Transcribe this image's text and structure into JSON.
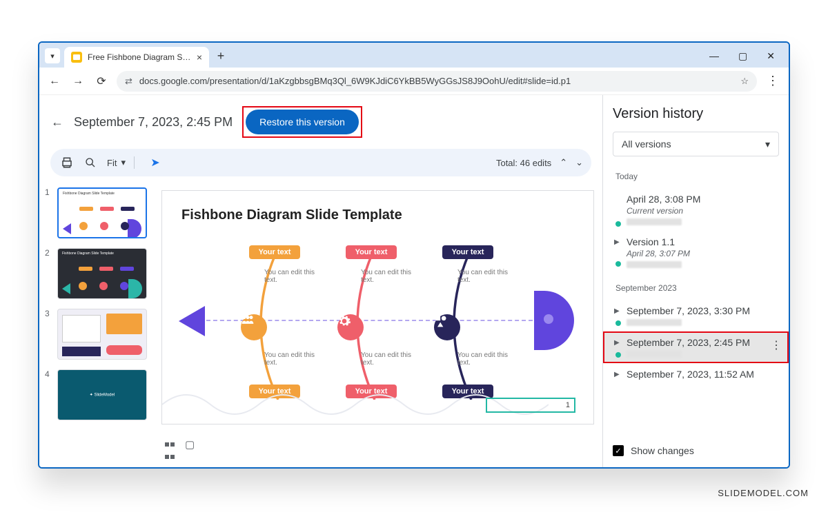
{
  "browser": {
    "tab_title": "Free Fishbone Diagram Slide Te",
    "url": "docs.google.com/presentation/d/1aKzgbbsgBMq3Ql_6W9KJdiC6YkBB5WyGGsJS8J9OohU/edit#slide=id.p1"
  },
  "header": {
    "date_title": "September 7, 2023, 2:45 PM",
    "restore_label": "Restore this version"
  },
  "toolbar": {
    "zoom_label": "Fit",
    "total_edits": "Total: 46 edits"
  },
  "slide": {
    "title": "Fishbone Diagram Slide Template",
    "cap_label": "Your text",
    "hint_text": "You can edit this text.",
    "page_number": "1"
  },
  "thumbnails": {
    "items": [
      {
        "num": "1"
      },
      {
        "num": "2"
      },
      {
        "num": "3"
      },
      {
        "num": "4"
      }
    ]
  },
  "sidebar": {
    "title": "Version history",
    "dropdown_label": "All versions",
    "groups": {
      "today": "Today",
      "sept": "September 2023"
    },
    "versions": {
      "v0": {
        "name": "April 28, 3:08 PM",
        "sub": "Current version"
      },
      "v1": {
        "name": "Version 1.1",
        "sub": "April 28, 3:07 PM"
      },
      "v2": {
        "name": "September 7, 2023, 3:30 PM"
      },
      "v3": {
        "name": "September 7, 2023, 2:45 PM"
      },
      "v4": {
        "name": "September 7, 2023, 11:52 AM"
      }
    },
    "show_changes": "Show changes"
  },
  "watermark": "SLIDEMODEL.COM"
}
